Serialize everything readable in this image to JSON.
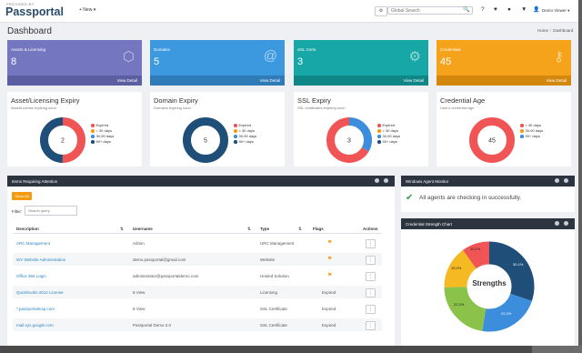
{
  "topbar": {
    "brand_small": "PROVIDED BY",
    "brand": "Passportal",
    "new_label": "+ New ▾",
    "search_placeholder": "Global Search",
    "user_label": "Demo Viewer ▾"
  },
  "page": {
    "title": "Dashboard",
    "breadcrumbs": [
      "Home",
      "Dashboard"
    ]
  },
  "tiles": [
    {
      "label": "Assets & Licensing",
      "count": "8",
      "link": "View Detail",
      "icon": "cubes-icon",
      "color": "#7477bf",
      "footer_color": "#5b5ea0"
    },
    {
      "label": "Domains",
      "count": "5",
      "link": "View Detail",
      "icon": "at-icon",
      "color": "#3c99e0",
      "footer_color": "#2f7bb8"
    },
    {
      "label": "SSL Certs",
      "count": "3",
      "link": "View Detail",
      "icon": "gear-icon",
      "color": "#17a7a7",
      "footer_color": "#0f8787"
    },
    {
      "label": "Credentials",
      "count": "45",
      "link": "View Detail",
      "icon": "key-icon",
      "color": "#f5a31a",
      "footer_color": "#d4870d"
    }
  ],
  "cards": [
    {
      "title": "Asset/Licensing Expiry",
      "subtitle": "Asset/License expiring soon",
      "center": "2",
      "legend": [
        {
          "label": "Expired",
          "color": "#f05454"
        },
        {
          "label": "< 30 days",
          "color": "#f39c12"
        },
        {
          "label": "30-90 days",
          "color": "#3c8ddc"
        },
        {
          "label": "90+ days",
          "color": "#1f4e79"
        }
      ],
      "segments": [
        {
          "value": 1,
          "color": "#f05454"
        },
        {
          "value": 1,
          "color": "#1f4e79"
        }
      ]
    },
    {
      "title": "Domain Expiry",
      "subtitle": "Domains expiring soon",
      "center": "5",
      "legend": [
        {
          "label": "Expired",
          "color": "#f05454"
        },
        {
          "label": "< 30 days",
          "color": "#f39c12"
        },
        {
          "label": "30-90 days",
          "color": "#3c8ddc"
        },
        {
          "label": "90+ days",
          "color": "#1f4e79"
        }
      ],
      "segments": [
        {
          "value": 5,
          "color": "#1f4e79"
        }
      ]
    },
    {
      "title": "SSL Expiry",
      "subtitle": "SSL certificates expiring soon",
      "center": "3",
      "legend": [
        {
          "label": "Expired",
          "color": "#f05454"
        },
        {
          "label": "< 30 days",
          "color": "#f39c12"
        },
        {
          "label": "30-90 days",
          "color": "#3c8ddc"
        },
        {
          "label": "90+ days",
          "color": "#1f4e79"
        }
      ],
      "segments": [
        {
          "value": 1,
          "color": "#3c8ddc"
        },
        {
          "value": 2,
          "color": "#f05454"
        }
      ]
    },
    {
      "title": "Credential Age",
      "subtitle": "User's credential age",
      "center": "45",
      "legend": [
        {
          "label": "< 30 days",
          "color": "#f05454"
        },
        {
          "label": "30-90 days",
          "color": "#f39c12"
        },
        {
          "label": "90+ days",
          "color": "#3c8ddc"
        }
      ],
      "segments": [
        {
          "value": 45,
          "color": "#f05454"
        }
      ]
    }
  ],
  "attention": {
    "title": "Items Requiring Attention",
    "show_all": "Show All",
    "filter_label": "Filter:",
    "filter_placeholder": "Search query",
    "columns": [
      "Description",
      "Username",
      "Type",
      "Flags",
      "Actions"
    ],
    "rows": [
      {
        "description": "ARC Management",
        "username": "Admin",
        "type": "URC Management",
        "flags": "",
        "flag": true
      },
      {
        "description": "WV Website Administration",
        "username": "demo.passportal@gmail.com",
        "type": "Website",
        "flags": "",
        "flag": true
      },
      {
        "description": "Office 365 Login",
        "username": "administrator@passportaldemo.com",
        "type": "Hosted Solution",
        "flags": "",
        "flag": true
      },
      {
        "description": "Quickbooks 2012 License",
        "username": "8 View",
        "type": "Licensing",
        "flags": "Expired",
        "flag": false
      },
      {
        "description": "*.passportalmsp.com",
        "username": "8 View",
        "type": "SSL Certificate",
        "flags": "Expired",
        "flag": false
      },
      {
        "description": "mail.xyz.google.com",
        "username": "Passportal Demo 2.0",
        "type": "SSL Certificate",
        "flags": "Expired",
        "flag": false
      }
    ]
  },
  "agents": {
    "title": "Windows Agent Monitor",
    "message": "All agents are checking in successfully."
  },
  "strength": {
    "title": "Credential Strength Chart",
    "center_label": "Strengths",
    "segments": [
      {
        "label": "30.1%",
        "value": 30.1,
        "color": "#1f4e79"
      },
      {
        "label": "22.2%",
        "value": 22.2,
        "color": "#3c8ddc"
      },
      {
        "label": "22.2%",
        "value": 22.2,
        "color": "#8bc34a"
      },
      {
        "label": "15.2%",
        "value": 15.2,
        "color": "#f5b921"
      },
      {
        "label": "10.1%",
        "value": 10.1,
        "color": "#f05454"
      }
    ]
  },
  "chart_data": [
    {
      "type": "pie",
      "title": "Asset/Licensing Expiry",
      "labels": [
        "Expired",
        "90+ days"
      ],
      "values": [
        1,
        1
      ]
    },
    {
      "type": "pie",
      "title": "Domain Expiry",
      "labels": [
        "90+ days"
      ],
      "values": [
        5
      ]
    },
    {
      "type": "pie",
      "title": "SSL Expiry",
      "labels": [
        "30-90 days",
        "Expired"
      ],
      "values": [
        1,
        2
      ]
    },
    {
      "type": "pie",
      "title": "Credential Age",
      "labels": [
        "< 30 days"
      ],
      "values": [
        45
      ]
    },
    {
      "type": "pie",
      "title": "Credential Strength Chart",
      "labels": [
        "30.1%",
        "22.2%",
        "22.2%",
        "15.2%",
        "10.1%"
      ],
      "values": [
        30.1,
        22.2,
        22.2,
        15.2,
        10.1
      ]
    }
  ]
}
